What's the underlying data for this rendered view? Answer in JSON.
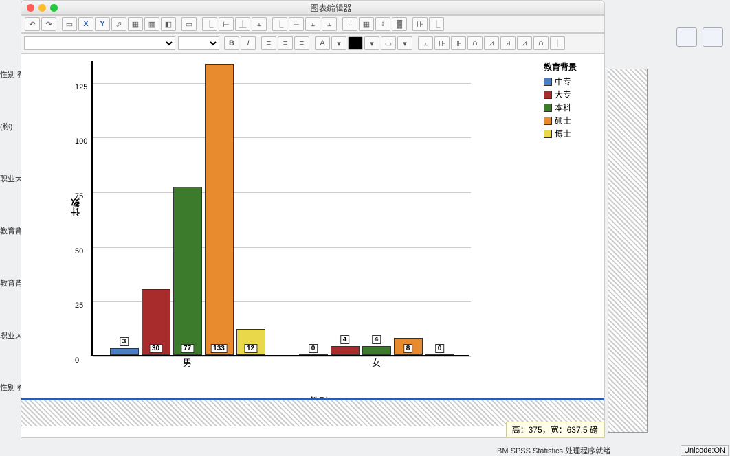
{
  "window": {
    "title": "图表编辑器"
  },
  "toolbar1": {
    "undo": "↶",
    "redo": "↷",
    "x": "X",
    "y": "Y"
  },
  "toolbar2": {
    "bold": "B",
    "italic": "I",
    "text_button": "A"
  },
  "legend": {
    "title": "教育背景",
    "items": [
      "中专",
      "大专",
      "本科",
      "硕士",
      "博士"
    ]
  },
  "chart_data": {
    "type": "bar",
    "title": "",
    "xlabel": "性别",
    "ylabel": "计数",
    "ylim": [
      0,
      130
    ],
    "yticks": [
      0,
      25,
      50,
      75,
      100,
      125
    ],
    "categories": [
      "男",
      "女"
    ],
    "series": [
      {
        "name": "中专",
        "color": "#4a7ec2",
        "values": [
          3,
          0
        ]
      },
      {
        "name": "大专",
        "color": "#a82c2c",
        "values": [
          30,
          4
        ]
      },
      {
        "name": "本科",
        "color": "#3c7a2c",
        "values": [
          77,
          4
        ]
      },
      {
        "name": "硕士",
        "color": "#e88b2e",
        "values": [
          133,
          8
        ]
      },
      {
        "name": "博士",
        "color": "#e8d84a",
        "values": [
          12,
          0
        ]
      }
    ]
  },
  "status": {
    "text": "高：375，宽：637.5 磅",
    "spss": "IBM SPSS Statistics 处理程序就绪",
    "unicode": "Unicode:ON"
  },
  "sidebar": {
    "items": [
      "性别 教",
      "(称)",
      "职业大",
      "教育背",
      "教育背",
      "职业大",
      "性别 教"
    ]
  }
}
